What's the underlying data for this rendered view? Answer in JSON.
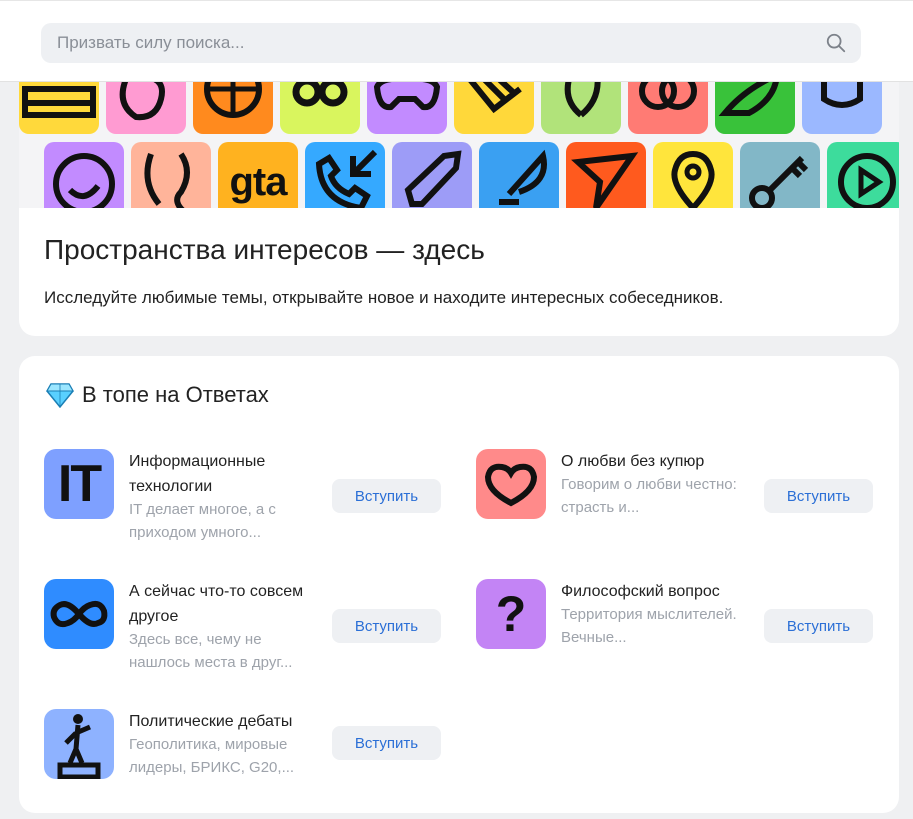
{
  "search": {
    "placeholder": "Призвать силу поиска..."
  },
  "hero": {
    "title": "Пространства интересов — здесь",
    "subtitle": "Исследуйте любимые темы, открывайте новое и находите интересных собеседников.",
    "gta_tile_text": "gta",
    "row1_colors": [
      "#ffd93b",
      "#ff9bd2",
      "#ff8a1e",
      "#d9f55e",
      "#c28bff",
      "#ffd83a",
      "#b1e37a",
      "#ff7b74",
      "#39c23a",
      "#9bb8ff"
    ],
    "row2_colors": [
      "#c28bff",
      "#ffb49a",
      "#ffb21f",
      "#35a9ff",
      "#9d9cf7",
      "#3aa0f2",
      "#ff5a1e",
      "#ffe53c",
      "#82b7c7",
      "#3ddc9c"
    ]
  },
  "top": {
    "title": "В топе на Ответах",
    "join_label": "Вступить",
    "communities": [
      {
        "name": "Информационные технологии",
        "desc": "IT делает многое, а с приходом умного...",
        "color": "#7ea0ff",
        "icon": "it-icon",
        "icon_text": "IT"
      },
      {
        "name": "О любви без купюр",
        "desc": "Говорим о любви честно: страсть и...",
        "color": "#ff8a8a",
        "icon": "heart-icon"
      },
      {
        "name": "А сейчас что-то совсем другое",
        "desc": "Здесь все, чему не нашлось места в друг...",
        "color": "#2f8cff",
        "icon": "infinity-icon"
      },
      {
        "name": "Философский вопрос",
        "desc": "Территория мыслителей. Вечные...",
        "color": "#c384f5",
        "icon": "question-icon",
        "icon_text": "?"
      },
      {
        "name": "Политические дебаты",
        "desc": "Геополитика, мировые лидеры, БРИКС, G20,...",
        "color": "#8eb2ff",
        "icon": "speaker-podium-icon"
      }
    ]
  }
}
